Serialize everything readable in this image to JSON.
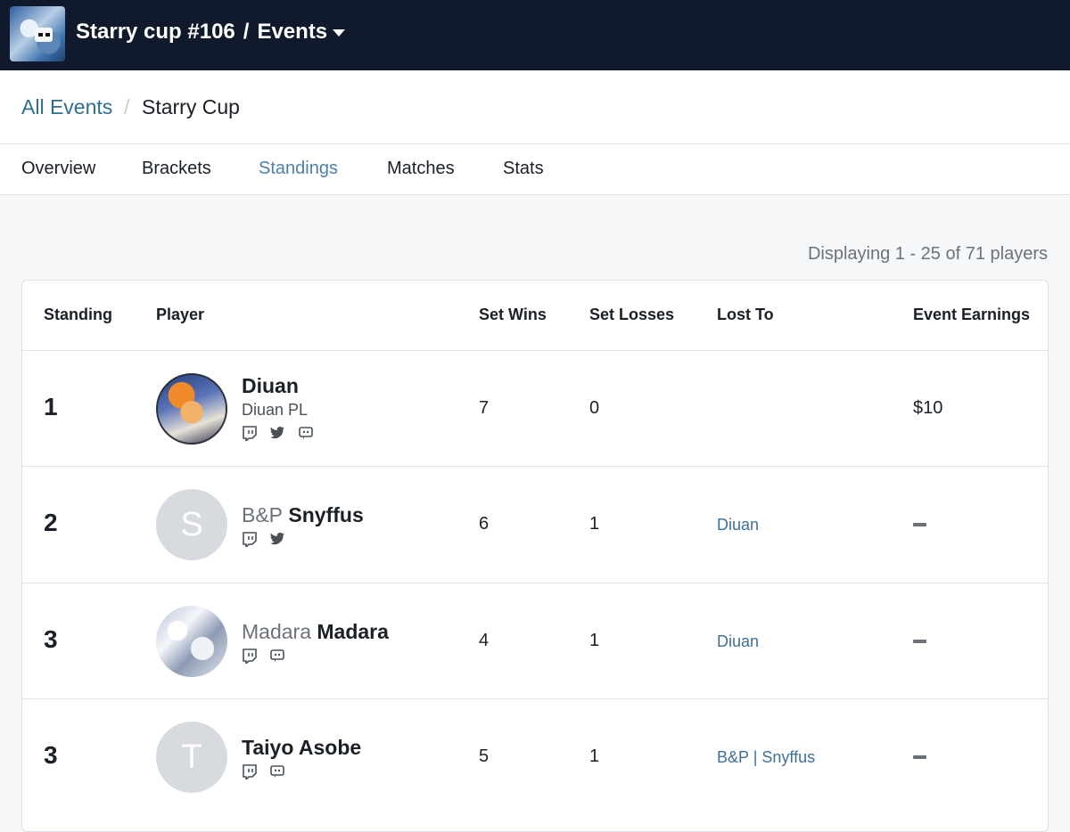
{
  "topbar": {
    "title": "Starry cup #106",
    "separator": "/",
    "section": "Events",
    "logo_icon": "tournament-logo"
  },
  "breadcrumb": {
    "parent": "All Events",
    "separator": "/",
    "current": "Starry Cup"
  },
  "tabs": [
    {
      "label": "Overview",
      "active": false
    },
    {
      "label": "Brackets",
      "active": false
    },
    {
      "label": "Standings",
      "active": true
    },
    {
      "label": "Matches",
      "active": false
    },
    {
      "label": "Stats",
      "active": false
    }
  ],
  "display_count": "Displaying 1 - 25 of 71 players",
  "table": {
    "headers": {
      "standing": "Standing",
      "player": "Player",
      "set_wins": "Set Wins",
      "set_losses": "Set Losses",
      "lost_to": "Lost To",
      "earnings": "Event Earnings"
    },
    "rows": [
      {
        "standing": "1",
        "prefix": "",
        "name": "Diuan",
        "subtitle": "Diuan PL",
        "avatar": "image",
        "socials": [
          "twitch-icon",
          "twitter-icon",
          "discord-icon"
        ],
        "set_wins": "7",
        "set_losses": "0",
        "lost_to": "",
        "earnings": "$10"
      },
      {
        "standing": "2",
        "prefix": "B&P",
        "name": "Snyffus",
        "subtitle": "",
        "avatar": "S",
        "socials": [
          "twitch-icon",
          "twitter-icon"
        ],
        "set_wins": "6",
        "set_losses": "1",
        "lost_to": "Diuan",
        "earnings": ""
      },
      {
        "standing": "3",
        "prefix": "Madara",
        "name": "Madara",
        "subtitle": "",
        "avatar": "image",
        "socials": [
          "twitch-icon",
          "discord-icon"
        ],
        "set_wins": "4",
        "set_losses": "1",
        "lost_to": "Diuan",
        "earnings": ""
      },
      {
        "standing": "3",
        "prefix": "",
        "name": "Taiyo Asobe",
        "subtitle": "",
        "avatar": "T",
        "socials": [
          "twitch-icon",
          "discord-icon"
        ],
        "set_wins": "5",
        "set_losses": "1",
        "lost_to": "B&P | Snyffus",
        "earnings": ""
      }
    ]
  },
  "colors": {
    "topbar_bg": "#111a2c",
    "link": "#2e6e8e",
    "active_tab": "#4f7fa8",
    "lost_to_link": "#3f6f96"
  }
}
